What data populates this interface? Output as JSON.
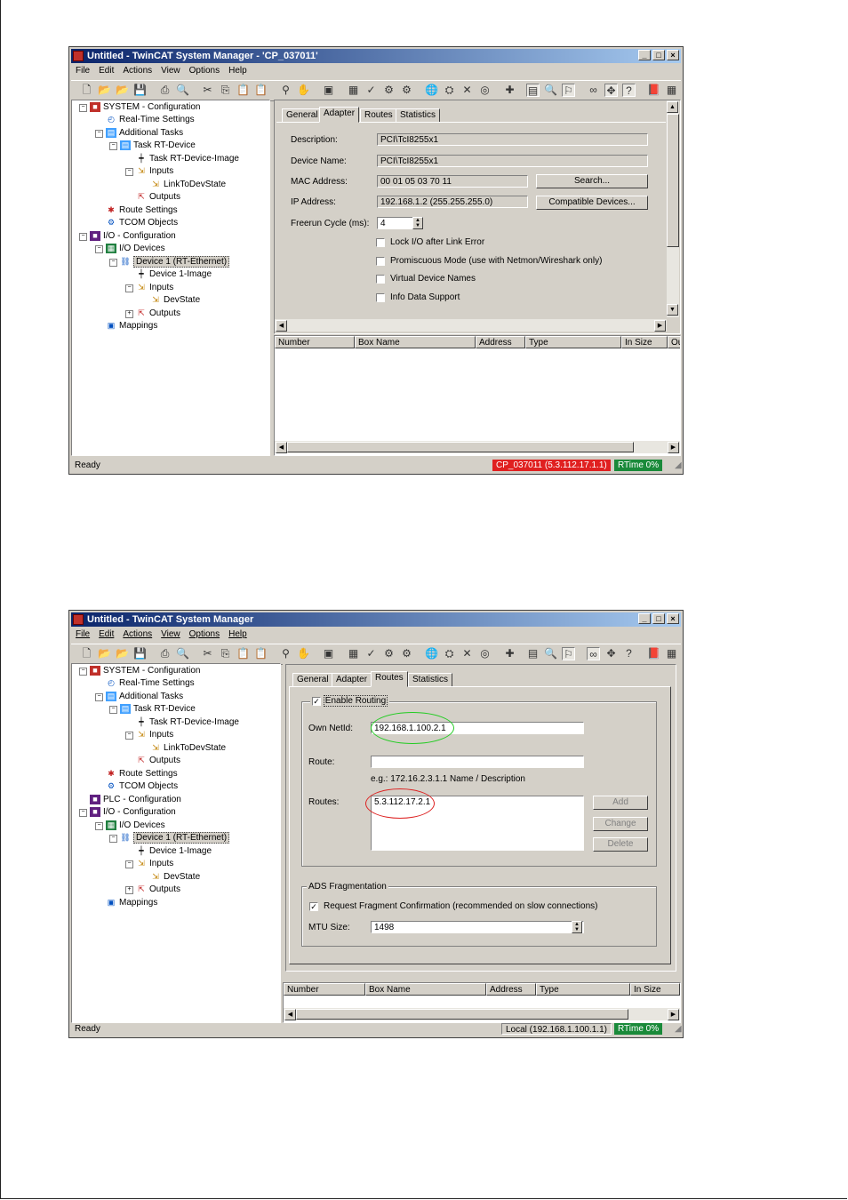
{
  "window1": {
    "title": "Untitled - TwinCAT System Manager - 'CP_037011'",
    "menu": [
      "File",
      "Edit",
      "Actions",
      "View",
      "Options",
      "Help"
    ],
    "tree": [
      {
        "label": "SYSTEM - Configuration",
        "icon": "system-icon"
      },
      {
        "label": "Real-Time Settings",
        "icon": "realtime-icon"
      },
      {
        "label": "Additional Tasks",
        "icon": "tasks-icon"
      },
      {
        "label": "Task RT-Device",
        "icon": "task-icon"
      },
      {
        "label": "Task RT-Device-Image",
        "icon": "image-icon"
      },
      {
        "label": "Inputs",
        "icon": "inputs-icon"
      },
      {
        "label": "LinkToDevState",
        "icon": "variable-icon"
      },
      {
        "label": "Outputs",
        "icon": "outputs-icon"
      },
      {
        "label": "Route Settings",
        "icon": "route-icon"
      },
      {
        "label": "TCOM Objects",
        "icon": "tcom-icon"
      },
      {
        "label": "I/O - Configuration",
        "icon": "io-icon"
      },
      {
        "label": "I/O Devices",
        "icon": "devices-icon"
      },
      {
        "label": "Device 1 (RT-Ethernet)",
        "icon": "ethernet-icon"
      },
      {
        "label": "Device 1-Image",
        "icon": "image-icon"
      },
      {
        "label": "Inputs",
        "icon": "inputs-icon"
      },
      {
        "label": "DevState",
        "icon": "variable-icon"
      },
      {
        "label": "Outputs",
        "icon": "outputs-icon"
      },
      {
        "label": "Mappings",
        "icon": "mappings-icon"
      }
    ],
    "tabs": [
      "General",
      "Adapter",
      "Routes",
      "Statistics"
    ],
    "adapter": {
      "description_label": "Description:",
      "description": "PCI\\TcI8255x1",
      "device_name_label": "Device Name:",
      "device_name": "PCI\\TcI8255x1",
      "mac_label": "MAC Address:",
      "mac": "00 01 05 03 70 11",
      "ip_label": "IP Address:",
      "ip": "192.168.1.2 (255.255.255.0)",
      "freerun_label": "Freerun Cycle (ms):",
      "freerun": "4",
      "search_button": "Search...",
      "compatible_button": "Compatible Devices...",
      "options": [
        {
          "label": "Lock I/O after Link Error",
          "checked": false
        },
        {
          "label": "Promiscuous Mode (use with Netmon/Wireshark only)",
          "checked": false
        },
        {
          "label": "Virtual Device Names",
          "checked": false
        },
        {
          "label": "Info Data Support",
          "checked": false
        }
      ]
    },
    "columns": [
      "Number",
      "Box Name",
      "Address",
      "Type",
      "In Size",
      "Ou"
    ],
    "status": {
      "ready": "Ready",
      "target": "CP_037011 (5.3.112.17.1.1)",
      "rtime": "RTime 0%"
    }
  },
  "window2": {
    "title": "Untitled - TwinCAT System Manager",
    "menu": [
      "File",
      "Edit",
      "Actions",
      "View",
      "Options",
      "Help"
    ],
    "tree": [
      {
        "label": "SYSTEM - Configuration",
        "icon": "system-icon"
      },
      {
        "label": "Real-Time Settings",
        "icon": "realtime-icon"
      },
      {
        "label": "Additional Tasks",
        "icon": "tasks-icon"
      },
      {
        "label": "Task RT-Device",
        "icon": "task-icon"
      },
      {
        "label": "Task RT-Device-Image",
        "icon": "image-icon"
      },
      {
        "label": "Inputs",
        "icon": "inputs-icon"
      },
      {
        "label": "LinkToDevState",
        "icon": "variable-icon"
      },
      {
        "label": "Outputs",
        "icon": "outputs-icon"
      },
      {
        "label": "Route Settings",
        "icon": "route-icon"
      },
      {
        "label": "TCOM Objects",
        "icon": "tcom-icon"
      },
      {
        "label": "PLC - Configuration",
        "icon": "plc-icon"
      },
      {
        "label": "I/O - Configuration",
        "icon": "io-icon"
      },
      {
        "label": "I/O Devices",
        "icon": "devices-icon"
      },
      {
        "label": "Device 1 (RT-Ethernet)",
        "icon": "ethernet-icon"
      },
      {
        "label": "Device 1-Image",
        "icon": "image-icon"
      },
      {
        "label": "Inputs",
        "icon": "inputs-icon"
      },
      {
        "label": "DevState",
        "icon": "variable-icon"
      },
      {
        "label": "Outputs",
        "icon": "outputs-icon"
      },
      {
        "label": "Mappings",
        "icon": "mappings-icon"
      }
    ],
    "tabs": [
      "General",
      "Adapter",
      "Routes",
      "Statistics"
    ],
    "routes": {
      "enable_routing_label": "Enable Routing",
      "enable_routing": true,
      "own_netid_label": "Own NetId:",
      "own_netid": "192.168.1.100.2.1",
      "route_label": "Route:",
      "route_value": "",
      "example": "e.g.: 172.16.2.3.1.1  Name / Description",
      "routes_label": "Routes:",
      "routes_list": [
        "5.3.112.17.2.1"
      ],
      "add_button": "Add",
      "change_button": "Change",
      "delete_button": "Delete",
      "ads_group": "ADS Fragmentation",
      "request_fragment_label": "Request Fragment Confirmation (recommended on slow connections)",
      "request_fragment": true,
      "mtu_label": "MTU Size:",
      "mtu": "1498"
    },
    "columns": [
      "Number",
      "Box Name",
      "Address",
      "Type",
      "In Size"
    ],
    "status": {
      "ready": "Ready",
      "target": "Local (192.168.1.100.1.1)",
      "rtime": "RTime 0%"
    }
  },
  "colors": {
    "title_start": "#0a246a",
    "title_end": "#a6caf0",
    "target_bad": "#e02020",
    "rtime_ok": "#1a8a3a",
    "highlight_green": "#22cc22",
    "highlight_red": "#dd2222"
  }
}
